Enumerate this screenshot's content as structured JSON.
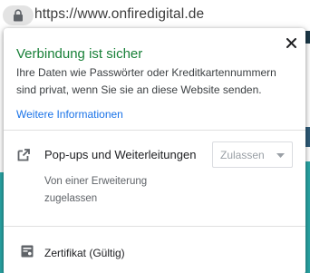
{
  "omnibox": {
    "url": "https://www.onfiredigital.de",
    "lock_icon": "lock-icon"
  },
  "popup": {
    "title": "Verbindung ist sicher",
    "description": "Ihre Daten wie Passwörter oder Kreditkartennummern sind privat, wenn Sie sie an diese Website senden.",
    "more_info_link": "Weitere Informationen",
    "close_icon": "close-icon",
    "title_color": "#188038",
    "link_color": "#1a73e8"
  },
  "permission": {
    "icon": "open-in-new-icon",
    "label": "Pop-ups und Weiterleitungen",
    "sublabel": "Von einer Erweiterung zugelassen",
    "select_value": "Zulassen"
  },
  "certificate": {
    "icon": "certificate-icon",
    "label": "Zertifikat (Gültig)"
  }
}
